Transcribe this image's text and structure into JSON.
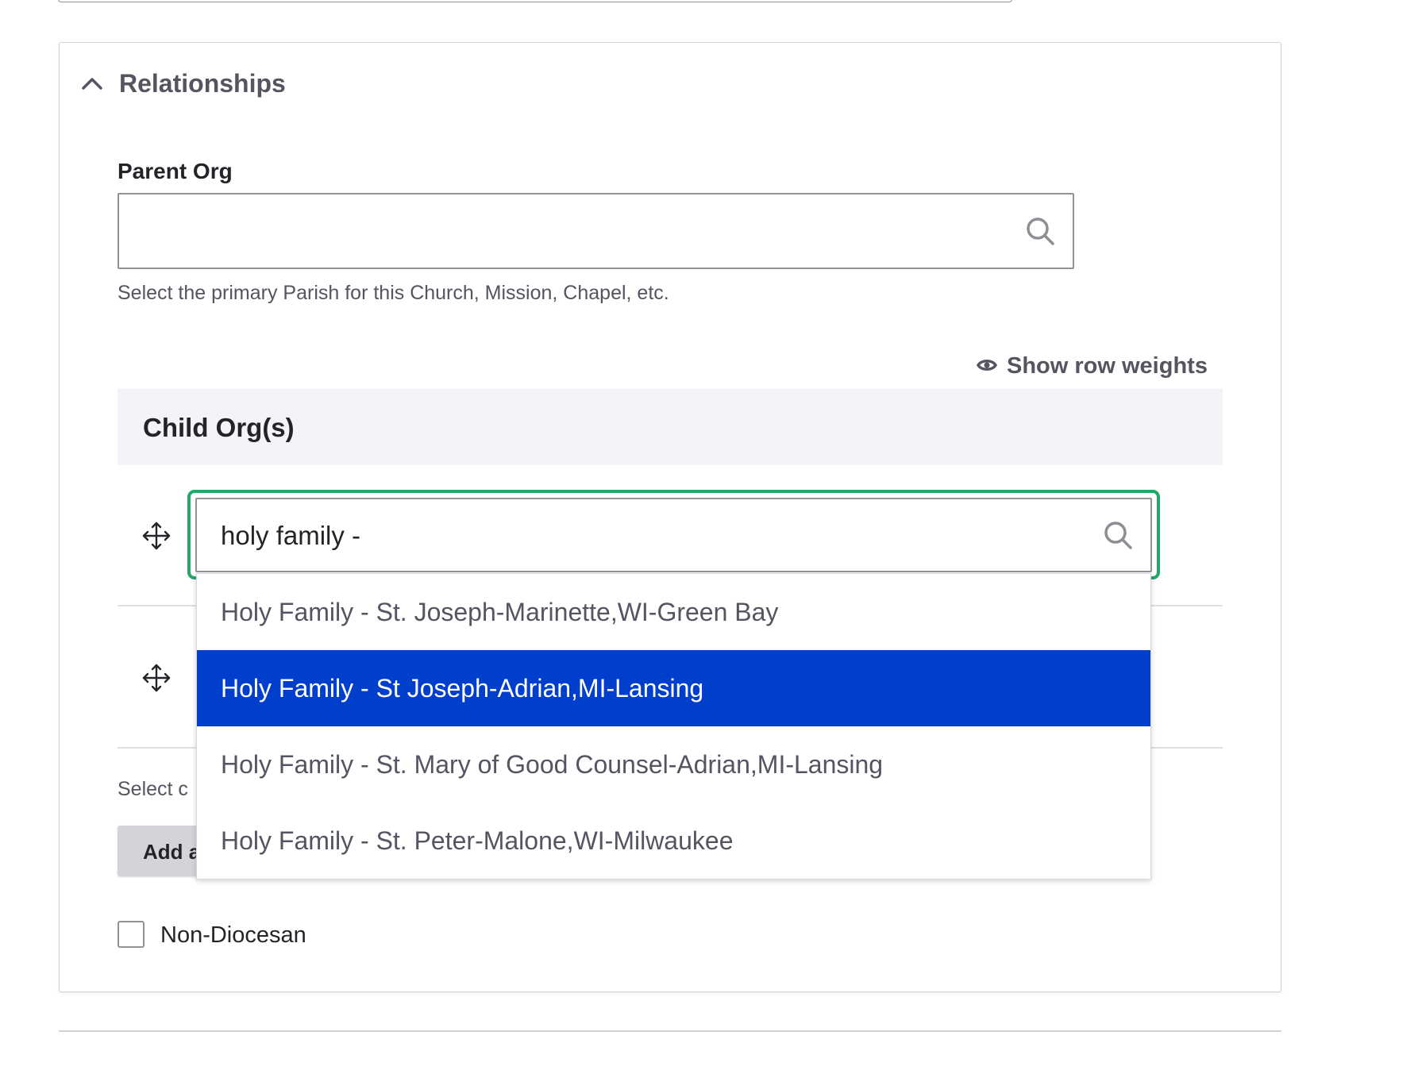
{
  "section": {
    "title": "Relationships",
    "icon": "chevron-up-icon"
  },
  "parent_org": {
    "label": "Parent Org",
    "value": "",
    "description": "Select the primary Parish for this Church, Mission, Chapel, etc.",
    "icon": "search-icon"
  },
  "child_orgs": {
    "show_weights_label": "Show row weights",
    "header": "Child Org(s)",
    "rows": [
      {
        "value": "holy family -"
      },
      {
        "value": ""
      }
    ],
    "description_visible": "Select c",
    "add_button_visible": "Add a"
  },
  "autocomplete": {
    "options": [
      {
        "label": "Holy Family - St. Joseph-Marinette,WI-Green Bay",
        "active": false
      },
      {
        "label": "Holy Family - St Joseph-Adrian,MI-Lansing",
        "active": true
      },
      {
        "label": "Holy Family - St. Mary of Good Counsel-Adrian,MI-Lansing",
        "active": false
      },
      {
        "label": "Holy Family - St. Peter-Malone,WI-Milwaukee",
        "active": false
      }
    ]
  },
  "non_diocesan": {
    "label": "Non-Diocesan",
    "checked": false
  },
  "colors": {
    "focus": "#26a769",
    "active_option": "#003ecc",
    "header_bg": "#f3f4f9"
  }
}
